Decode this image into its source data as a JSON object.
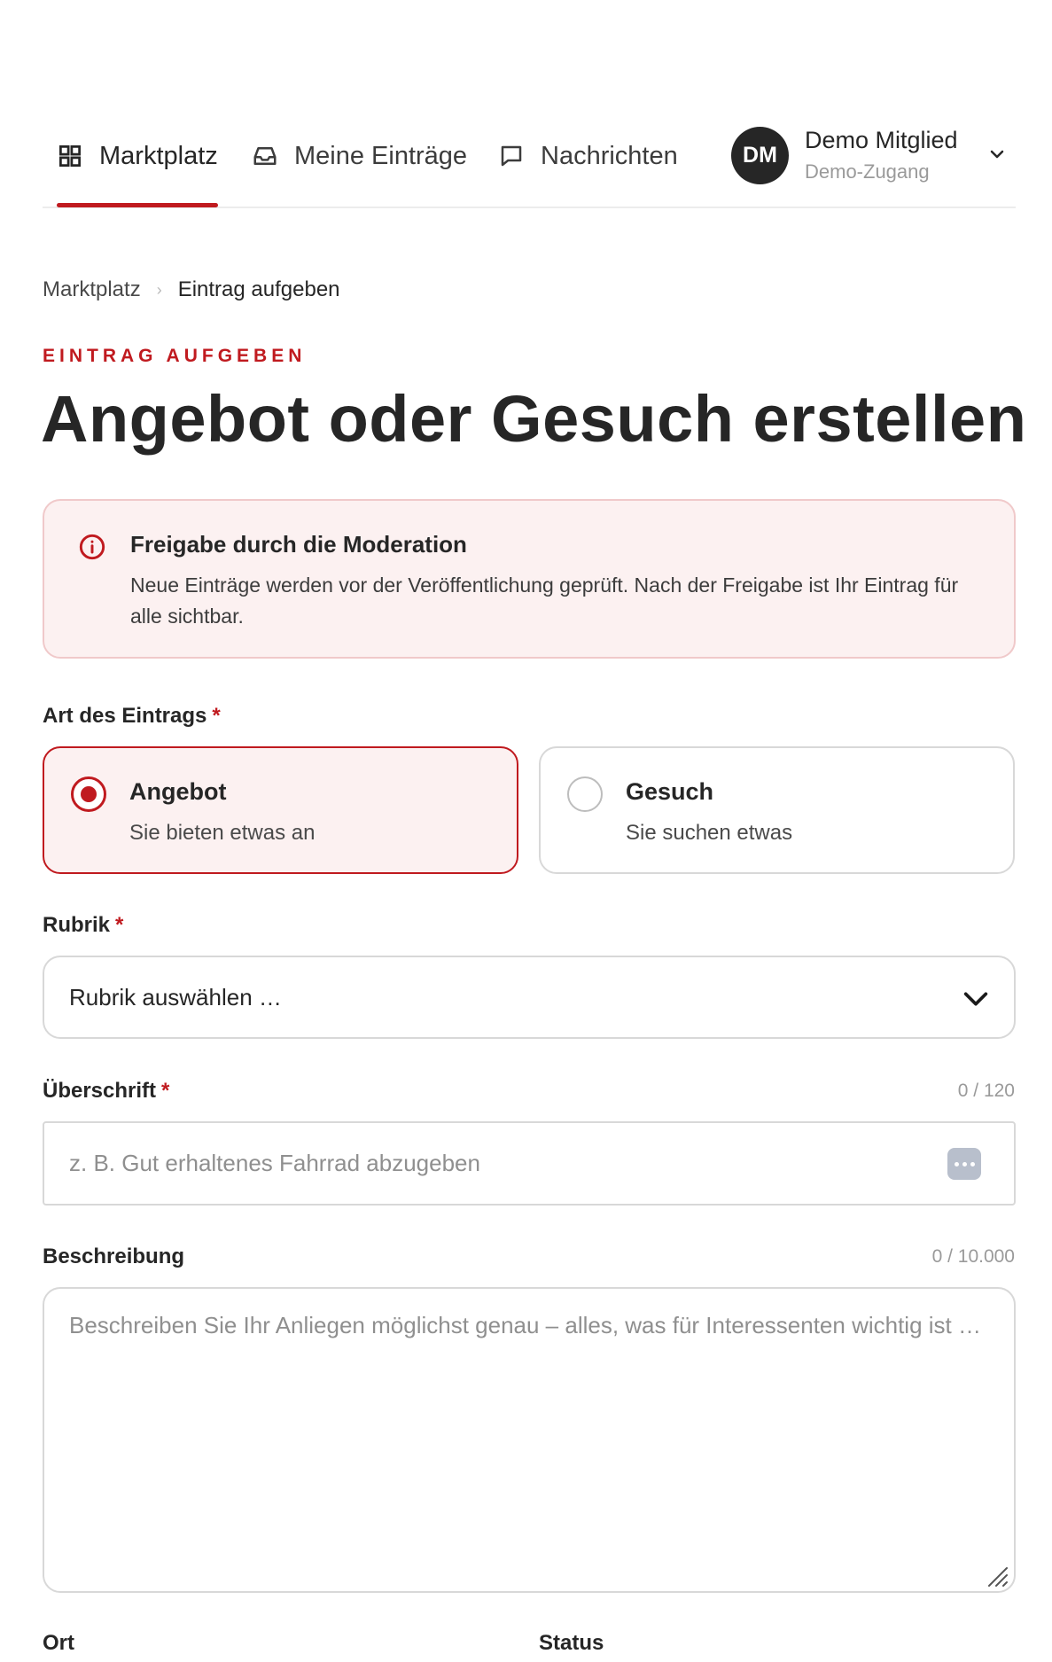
{
  "nav": {
    "tabs": [
      {
        "label": "Marktplatz",
        "icon": "grid-icon",
        "active": true
      },
      {
        "label": "Meine Einträge",
        "icon": "inbox-icon",
        "active": false
      },
      {
        "label": "Nachrichten",
        "icon": "chat-icon",
        "active": false
      }
    ],
    "user": {
      "initials": "DM",
      "name": "Demo Mitglied",
      "subtitle": "Demo-Zugang"
    }
  },
  "breadcrumb": {
    "parent": "Marktplatz",
    "separator": "›",
    "current": "Eintrag aufgeben"
  },
  "page": {
    "eyebrow": "EINTRAG AUFGEBEN",
    "title": "Angebot oder Gesuch erstellen"
  },
  "notice": {
    "title": "Freigabe durch die Moderation",
    "text": "Neue Einträge werden vor der Veröffentlichung geprüft. Nach der Freigabe ist Ihr Eintrag für alle sichtbar."
  },
  "form": {
    "type": {
      "label": "Art des Eintrags",
      "required_mark": "*",
      "options": [
        {
          "title": "Angebot",
          "subtitle": "Sie bieten etwas an",
          "selected": true
        },
        {
          "title": "Gesuch",
          "subtitle": "Sie suchen etwas",
          "selected": false
        }
      ]
    },
    "category": {
      "label": "Rubrik",
      "required_mark": "*",
      "value": "Rubrik auswählen …"
    },
    "headline": {
      "label": "Überschrift",
      "required_mark": "*",
      "counter": "0 / 120",
      "value": "",
      "placeholder": "z. B. Gut erhaltenes Fahrrad abzugeben"
    },
    "description": {
      "label": "Beschreibung",
      "counter": "0 / 10.000",
      "value": "",
      "placeholder": "Beschreiben Sie Ihr Anliegen möglichst genau – alles, was für Interessenten wichtig ist …"
    },
    "location": {
      "label": "Ort"
    },
    "status": {
      "label": "Status"
    }
  },
  "colors": {
    "accent": "#c01a1f",
    "accent_bg": "#fcf1f1",
    "text": "#262626",
    "muted": "#9a9a9a",
    "border": "#d8d8d8"
  }
}
